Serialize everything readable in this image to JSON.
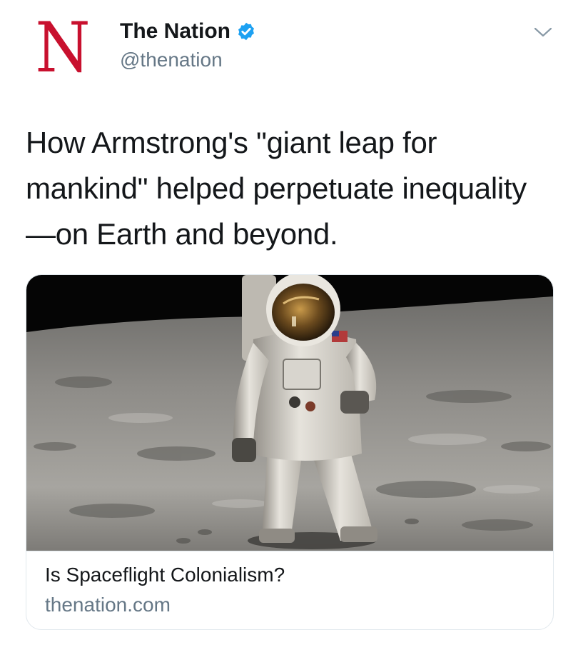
{
  "account": {
    "display_name": "The Nation",
    "handle": "@thenation",
    "avatar_letter": "N",
    "brand_color": "#c8102e",
    "verified_color": "#1da1f2"
  },
  "tweet": {
    "text": "How Armstrong's \"giant leap for mankind\" helped perpetuate inequality—on Earth and beyond."
  },
  "card": {
    "title": "Is Spaceflight Colonialism?",
    "domain": "thenation.com",
    "image_icon": "astronaut-on-moon-photo"
  },
  "icons": {
    "verified": "verified-badge-icon",
    "menu": "chevron-down-icon"
  }
}
